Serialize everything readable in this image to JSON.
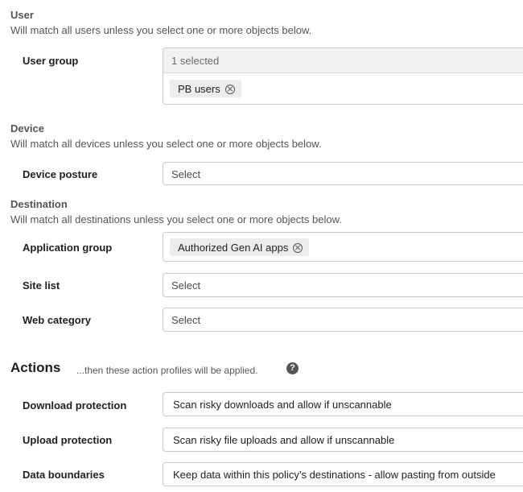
{
  "user": {
    "title": "User",
    "desc": "Will match all users unless you select one or more objects below.",
    "user_group": {
      "label": "User group",
      "header": "1 selected",
      "chips": [
        "PB users"
      ]
    }
  },
  "device": {
    "title": "Device",
    "desc": "Will match all devices unless you select one or more objects below.",
    "posture": {
      "label": "Device posture",
      "placeholder": "Select"
    }
  },
  "destination": {
    "title": "Destination",
    "desc": "Will match all destinations unless you select one or more objects below.",
    "app_group": {
      "label": "Application group",
      "chips": [
        "Authorized Gen AI apps"
      ]
    },
    "site_list": {
      "label": "Site list",
      "placeholder": "Select"
    },
    "web_category": {
      "label": "Web category",
      "placeholder": "Select"
    }
  },
  "actions": {
    "title": "Actions",
    "desc": "...then these action profiles will be applied.",
    "help_icon": "question-circle-icon",
    "download": {
      "label": "Download protection",
      "value": "Scan risky downloads and allow if unscannable"
    },
    "upload": {
      "label": "Upload protection",
      "value": "Scan risky file uploads and allow if unscannable"
    },
    "boundaries": {
      "label": "Data boundaries",
      "value": "Keep data within this policy’s destinations - allow pasting from outside"
    }
  }
}
